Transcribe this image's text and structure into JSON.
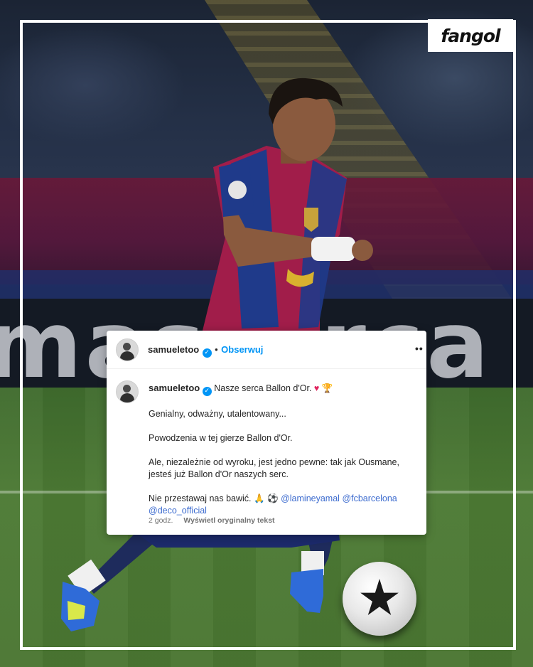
{
  "brand": {
    "logo_text": "fangol"
  },
  "background": {
    "ad_board_text": "masterca",
    "description_colors": {
      "pitch": "#4c7a34",
      "kit_blue": "#1f3a8a",
      "kit_red": "#a11d4a"
    }
  },
  "post": {
    "header": {
      "username": "samueletoo",
      "separator": "•",
      "follow_label": "Obserwuj",
      "more_label": "••"
    },
    "caption": {
      "username": "samueletoo",
      "first_line_text": "Nasze serca Ballon d'Or.",
      "first_line_emojis": "♥ 🏆",
      "paragraph_1": "Genialny, odważny, utalentowany...",
      "paragraph_2": "Powodzenia w tej gierze Ballon d'Or.",
      "paragraph_3_line_1": "Ale, niezależnie od wyroku, jest jedno pewne: tak jak Ousmane,",
      "paragraph_3_line_2": "jesteś już Ballon d'Or naszych serc.",
      "paragraph_4_text": "Nie przestawaj nas bawić.",
      "paragraph_4_emojis": "🙏 ⚽",
      "mention_1": "@lamineyamal",
      "mention_2": "@fcbarcelona",
      "mention_3": "@deco_official"
    },
    "meta": {
      "time": "2 godz.",
      "translate_label": "Wyświetl oryginalny tekst"
    },
    "accent_color": "#0095f6"
  }
}
